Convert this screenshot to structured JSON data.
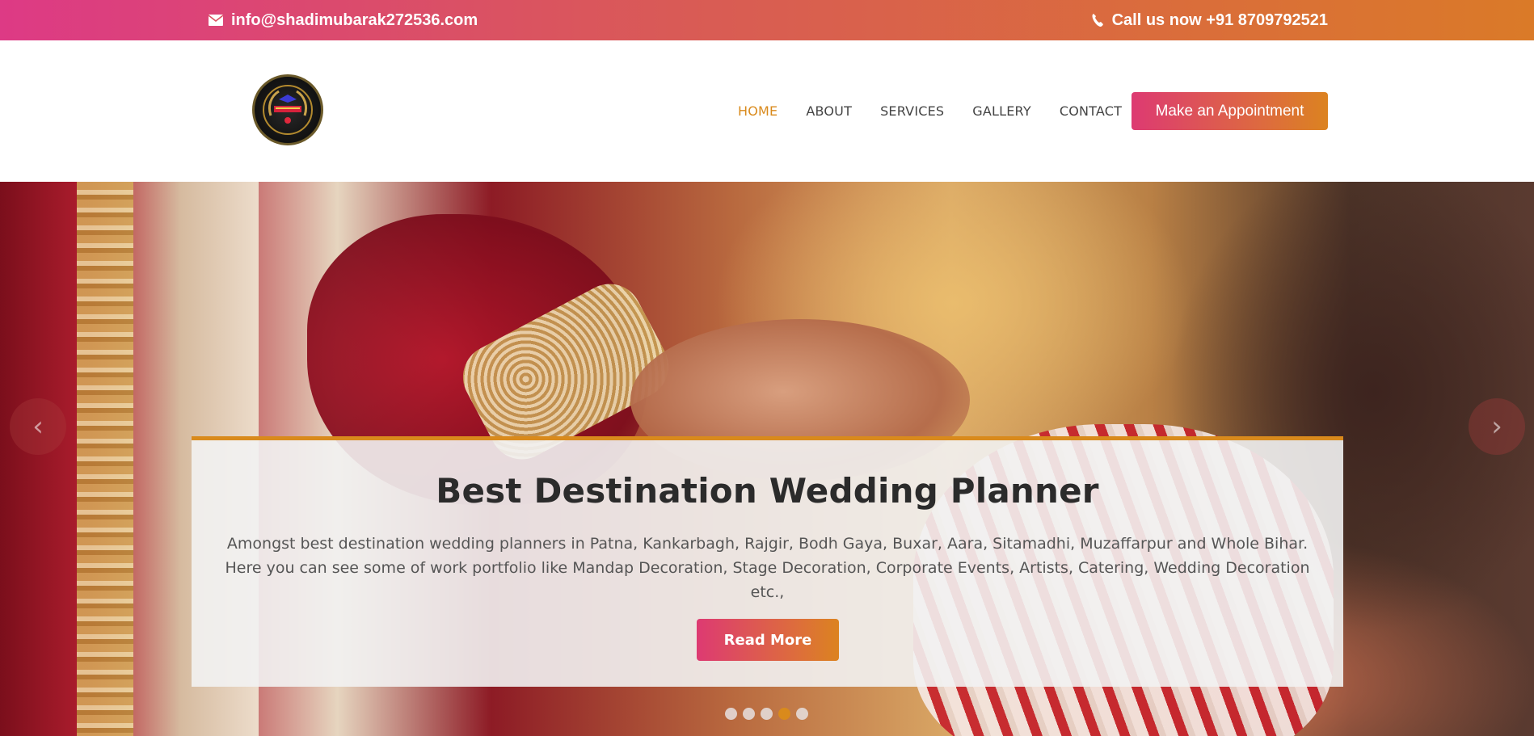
{
  "topbar": {
    "email_icon": "mail-icon",
    "email": "info@shadimubarak272536.com",
    "phone_icon": "phone-icon",
    "phone": "Call us now +91 8709792521"
  },
  "header": {
    "logo_icon": "brand-logo",
    "nav": [
      {
        "label": "HOME",
        "active": true
      },
      {
        "label": "ABOUT",
        "active": false
      },
      {
        "label": "SERVICES",
        "active": false
      },
      {
        "label": "GALLERY",
        "active": false
      },
      {
        "label": "CONTACT",
        "active": false
      }
    ],
    "cta_label": "Make an Appointment"
  },
  "hero": {
    "title": "Best Destination Wedding Planner",
    "text_line1": "Amongst best destination wedding planners in Patna, Kankarbagh, Rajgir, Bodh Gaya, Buxar, Aara, Sitamadhi, Muzaffarpur and Whole Bihar.",
    "text_line2": "Here you can see some of work portfolio like Mandap Decoration, Stage Decoration, Corporate Events, Artists, Catering, Wedding Decoration etc.,",
    "read_more_label": "Read More",
    "prev_icon": "chevron-left-icon",
    "next_icon": "chevron-right-icon",
    "slides_total": 5,
    "active_slide": 4
  },
  "colors": {
    "accent_orange": "#d98a1c",
    "accent_pink": "#dd3a85",
    "text_dark": "#2b2b2b",
    "nav_text": "#444444"
  }
}
